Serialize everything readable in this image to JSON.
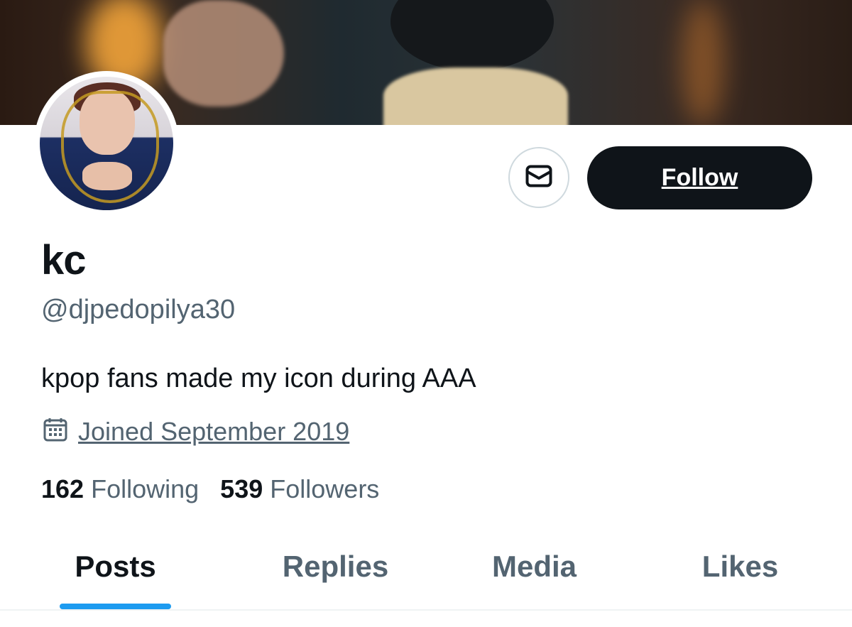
{
  "profile": {
    "display_name": "kc",
    "handle": "@djpedopilya30",
    "bio": "kpop fans made my icon during AAA",
    "joined": "Joined September 2019",
    "follow_label": "Follow"
  },
  "stats": {
    "following_count": "162",
    "following_label": "Following",
    "followers_count": "539",
    "followers_label": "Followers"
  },
  "tabs": [
    {
      "label": "Posts",
      "active": true
    },
    {
      "label": "Replies",
      "active": false
    },
    {
      "label": "Media",
      "active": false
    },
    {
      "label": "Likes",
      "active": false
    }
  ],
  "icons": {
    "message": "envelope-icon",
    "calendar": "calendar-icon"
  },
  "colors": {
    "text_primary": "#0f1419",
    "text_secondary": "#536471",
    "accent": "#1d9bf0",
    "follow_bg": "#0f1419"
  }
}
